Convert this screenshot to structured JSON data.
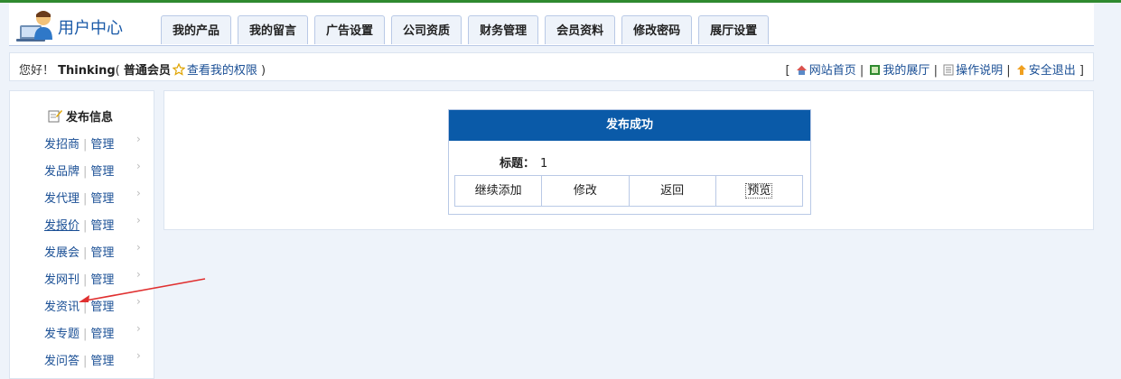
{
  "header": {
    "title": "用户中心",
    "tabs": [
      "我的产品",
      "我的留言",
      "广告设置",
      "公司资质",
      "财务管理",
      "会员资料",
      "修改密码",
      "展厅设置"
    ]
  },
  "userbar": {
    "greeting": "您好！",
    "username": "Thinking",
    "open_paren": "(",
    "level": "普通会员",
    "permission_link": "查看我的权限",
    "close_paren": ")",
    "links": [
      "网站首页",
      "我的展厅",
      "操作说明",
      "安全退出"
    ]
  },
  "sidebar": {
    "title": "发布信息",
    "manage_label": "管理",
    "items": [
      "发招商",
      "发品牌",
      "发代理",
      "发报价",
      "发展会",
      "发网刊",
      "发资讯",
      "发专题",
      "发问答"
    ]
  },
  "result": {
    "heading": "发布成功",
    "title_label": "标题：",
    "title_value": "1",
    "actions": [
      "继续添加",
      "修改",
      "返回",
      "预览"
    ]
  }
}
